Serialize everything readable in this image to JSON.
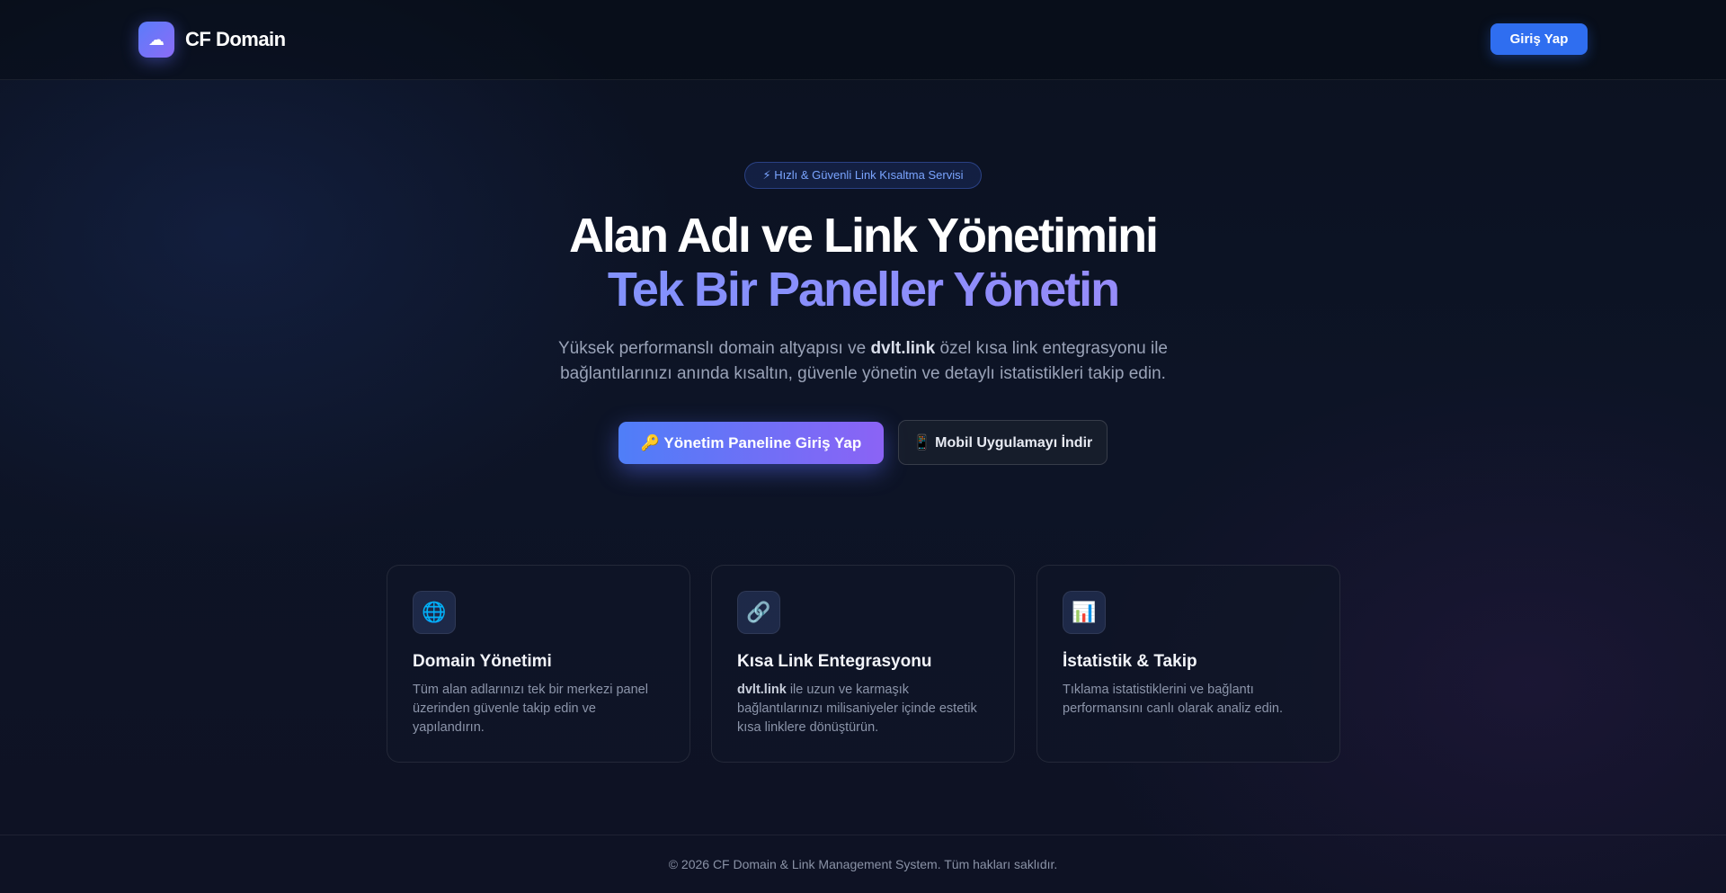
{
  "header": {
    "brand_icon": "cloud-icon",
    "brand_name": "CF Domain",
    "login_label": "Giriş Yap"
  },
  "hero": {
    "badge": "⚡ Hızlı & Güvenli Link Kısaltma Servisi",
    "title_line1": "Alan Adı ve Link Yönetimini",
    "title_line2": "Tek Bir Paneller Yönetin",
    "subtitle_part1": "Yüksek performanslı domain altyapısı ve ",
    "subtitle_highlight": "dvlt.link",
    "subtitle_part2": " özel kısa link entegrasyonu ile bağlantılarınızı anında kısaltın, güvenle yönetin ve detaylı istatistikleri takip edin.",
    "primary_cta": "🔑 Yönetim Paneline Giriş Yap",
    "secondary_cta": "📱 Mobil Uygulamayı İndir"
  },
  "features": [
    {
      "icon": "🌐",
      "icon_name": "globe-icon",
      "title": "Domain Yönetimi",
      "highlight": "",
      "desc": "Tüm alan adlarınızı tek bir merkezi panel üzerinden güvenle takip edin ve yapılandırın."
    },
    {
      "icon": "🔗",
      "icon_name": "link-icon",
      "title": "Kısa Link Entegrasyonu",
      "highlight": "dvlt.link",
      "desc": " ile uzun ve karmaşık bağlantılarınızı milisaniyeler içinde estetik kısa linklere dönüştürün."
    },
    {
      "icon": "📊",
      "icon_name": "bar-chart-icon",
      "title": "İstatistik & Takip",
      "highlight": "",
      "desc": "Tıklama istatistiklerini ve bağlantı performansını canlı olarak analiz edin."
    }
  ],
  "footer": {
    "copyright": "© 2026 CF Domain & Link Management System. Tüm hakları saklıdır."
  }
}
